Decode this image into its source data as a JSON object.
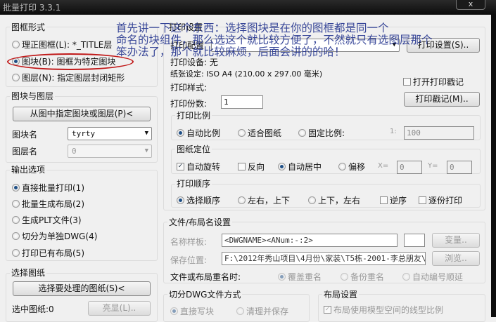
{
  "window": {
    "title": "批量打印 3.3.1",
    "close": "x"
  },
  "frame_form": {
    "title": "图框形式",
    "options": [
      "理正图框(L): *_TITLE层",
      "图块(B): 图框为特定图块",
      "图层(N): 指定图层封闭矩形"
    ],
    "selected": 1
  },
  "block_layer": {
    "title": "图块与图层",
    "pick_button": "从图中指定图块或图层(P)<",
    "block_label": "图块名",
    "block_value": "tyrty",
    "layer_label": "图层名",
    "layer_value": "0"
  },
  "output": {
    "title": "输出选项",
    "options": [
      "直接批量打印(1)",
      "批量生成布局(2)",
      "生成PLT文件(3)",
      "切分为单独DWG(4)",
      "打印已有布局(5)"
    ],
    "selected": 0
  },
  "select_sheets": {
    "title": "选择图纸",
    "select_button": "选择要处理的图纸(S)<",
    "selected_label": "选中图纸:0",
    "highlight_button": "亮显(L).."
  },
  "print_settings": {
    "title": "打印设置",
    "config_label": "打印配置",
    "setup_button": "打印设置(S)..",
    "device": "打印设备: 无",
    "paper": "纸张设定: ISO A4 (210.00 x 297.00 毫米)",
    "style": "打印样式:",
    "copies_label": "打印份数:",
    "copies": "1",
    "stamp_check": "打开打印戳记",
    "stamp_button": "打印戳记(M).."
  },
  "scale": {
    "title": "打印比例",
    "options": [
      "自动比例",
      "适合图纸",
      "固定比例:"
    ],
    "selected": 0,
    "ratio_prefix": "1:",
    "ratio": "100"
  },
  "position": {
    "title": "图纸定位",
    "auto_rotate": "自动旋转",
    "reverse": "反向",
    "options": [
      "自动居中",
      "偏移"
    ],
    "selected": 0,
    "x_label": "X=",
    "x": "0",
    "y_label": "Y=",
    "y": "0"
  },
  "order": {
    "title": "打印顺序",
    "options": [
      "选择顺序",
      "左右，上下",
      "上下，左右"
    ],
    "selected": 0,
    "reverse": "逆序",
    "collate": "逐份打印"
  },
  "naming": {
    "title": "文件/布局名设置",
    "template_label": "名称样板:",
    "template": "<DWGNAME><ANum:-:2>",
    "var_button": "变量..",
    "save_label": "保存位置:",
    "save_path": "F:\\2012年秀山项目\\4月份\\家装\\T5栋-2001-李总朋友\\",
    "browse_button": "浏览..",
    "rename_label": "文件或布局重名时:",
    "rename_options": [
      "覆盖重名",
      "备份重名",
      "自动编号顺延"
    ],
    "rename_selected": 0
  },
  "split": {
    "title": "切分DWG文件方式",
    "options": [
      "直接写块",
      "清理并保存"
    ],
    "selected": 0
  },
  "layout": {
    "title": "布局设置",
    "option": "布局使用模型空间的线型比例"
  },
  "annotation": {
    "lines": [
      "首先讲一下这个东西：选择图块是在你的图框都是同一个",
      "命名的块组件，那么选这个就比较方便了，不然就只有选图层那个",
      "笨办法了，那个就比较麻烦，后面会讲的的哈！"
    ],
    "color": "#1e2f8c"
  }
}
